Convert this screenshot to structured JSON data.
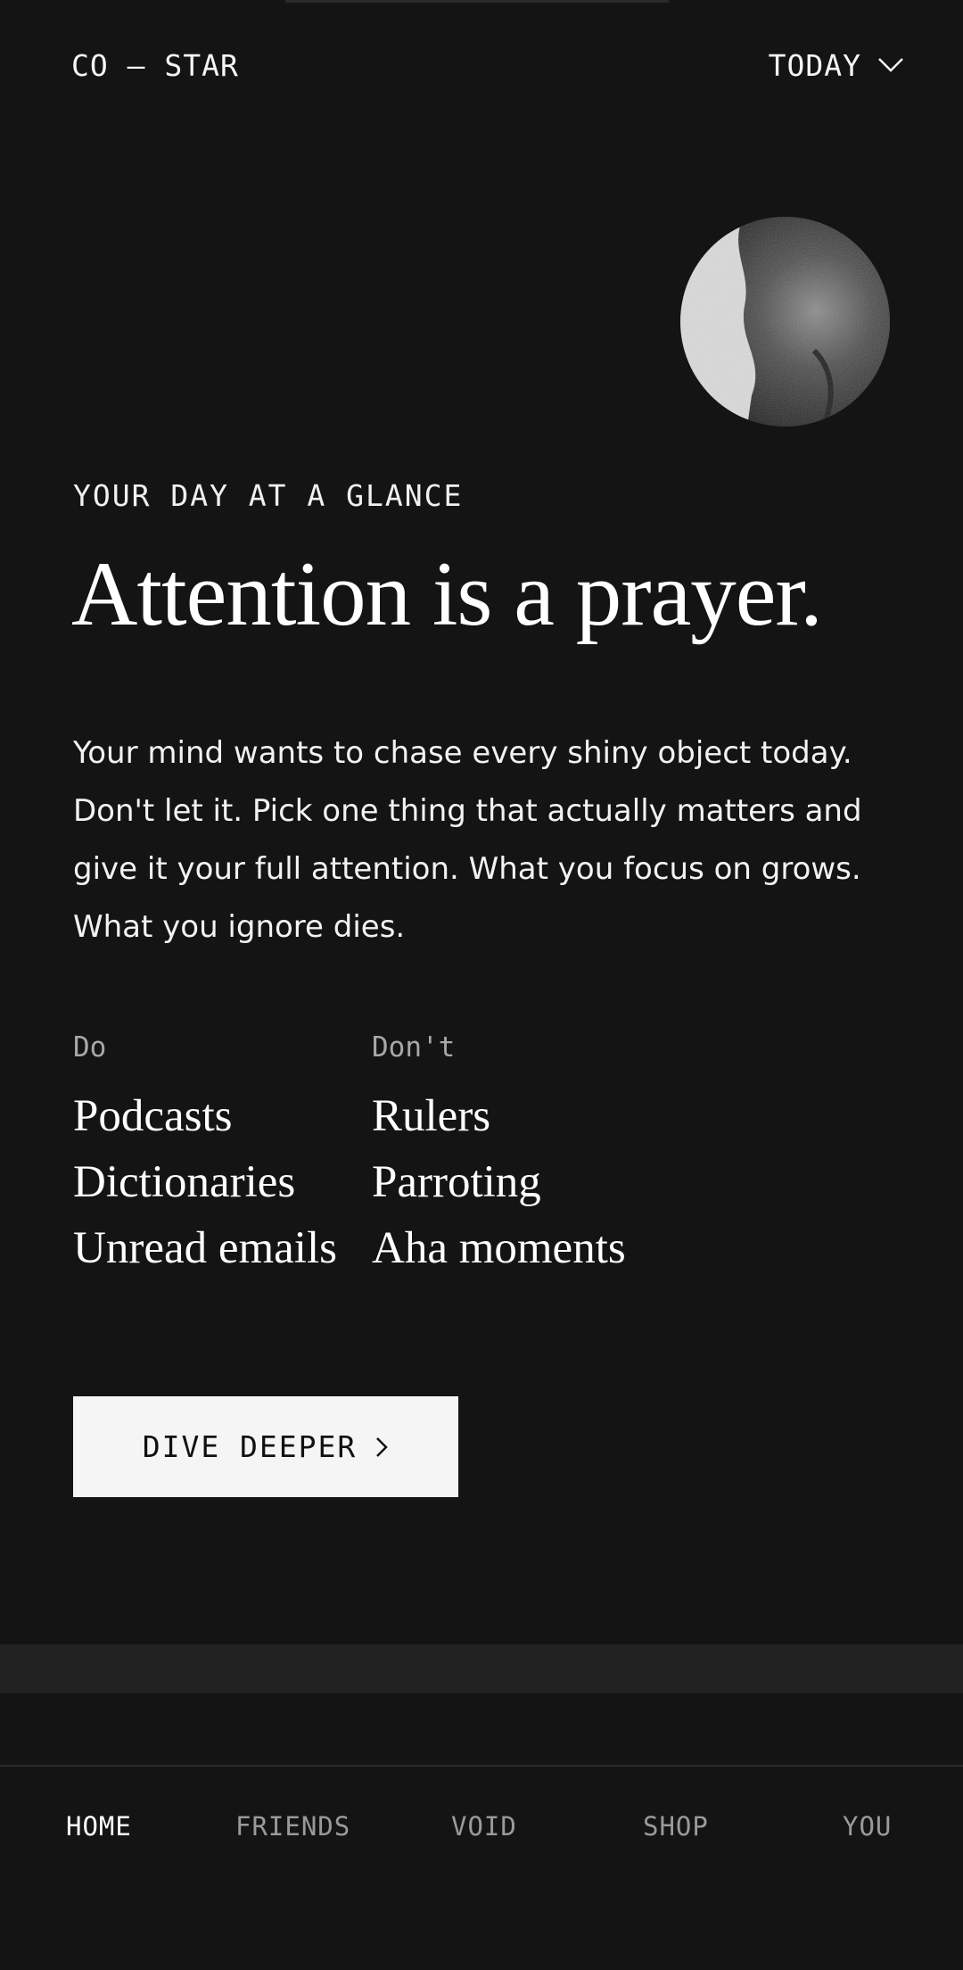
{
  "header": {
    "logo": "CO — STAR",
    "date_label": "TODAY"
  },
  "daily": {
    "eyebrow": "YOUR DAY AT A GLANCE",
    "headline": "Attention is a prayer.",
    "body": "Your mind wants to chase every shiny object today. Don't let it. Pick one thing that actually matters and give it your full attention. What you focus on grows. What you ignore dies."
  },
  "do_dont": {
    "do_label": "Do",
    "dont_label": "Don't",
    "do_items": [
      "Podcasts",
      "Dictionaries",
      "Unread emails"
    ],
    "dont_items": [
      "Rulers",
      "Parroting",
      "Aha moments"
    ]
  },
  "cta": {
    "label": "DIVE DEEPER"
  },
  "nav": {
    "items": [
      "HOME",
      "FRIENDS",
      "VOID",
      "SHOP",
      "YOU"
    ],
    "active": "HOME"
  },
  "icons": {
    "date_toggle": "chevron-down-icon",
    "cta_arrow": "chevron-right-icon"
  },
  "colors": {
    "background": "#141414",
    "text": "#ffffff",
    "muted": "#a8a8a8",
    "button_bg": "#f5f5f5",
    "button_text": "#111111"
  }
}
